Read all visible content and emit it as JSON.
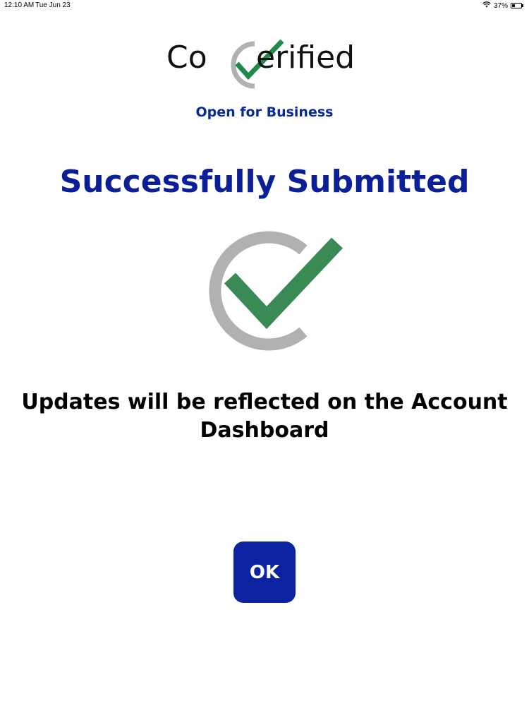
{
  "status_bar": {
    "time": "12:10 AM",
    "date": "Tue Jun 23",
    "battery_percent_text": "37%",
    "battery_level": 0.37
  },
  "logo": {
    "text_left": "Co",
    "text_right": "erified",
    "tagline": "Open for Business"
  },
  "title": "Successfully Submitted",
  "message": "Updates will be reflected on the Account Dashboard",
  "ok_button": {
    "label": "OK"
  },
  "colors": {
    "brand_blue": "#0b1f96",
    "button_blue": "#0b23a0",
    "check_green": "#3a8a55",
    "ring_gray": "#b1b1b3"
  }
}
